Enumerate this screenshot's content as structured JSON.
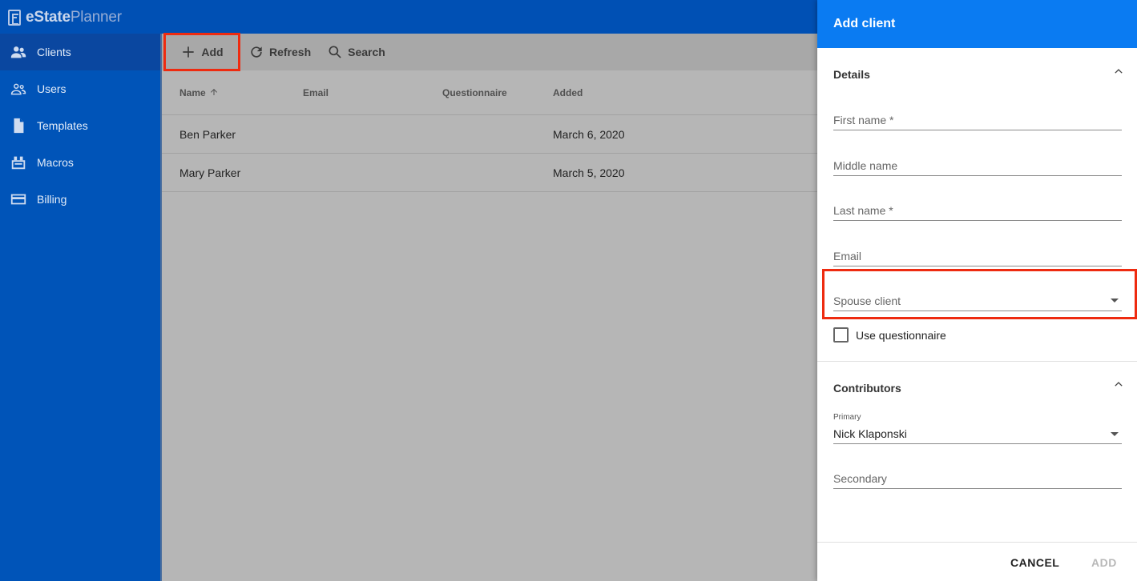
{
  "app": {
    "logo_bold": "eState",
    "logo_light": "Planner"
  },
  "sidebar": {
    "items": [
      {
        "label": "Clients",
        "icon": "people-icon",
        "active": true
      },
      {
        "label": "Users",
        "icon": "users-outline-icon"
      },
      {
        "label": "Templates",
        "icon": "document-icon"
      },
      {
        "label": "Macros",
        "icon": "macro-icon"
      },
      {
        "label": "Billing",
        "icon": "credit-card-icon"
      }
    ]
  },
  "toolbar": {
    "add_label": "Add",
    "refresh_label": "Refresh",
    "search_label": "Search"
  },
  "table": {
    "columns": [
      "Name",
      "Email",
      "Questionnaire",
      "Added"
    ],
    "rows": [
      {
        "name": "Ben Parker",
        "email": "",
        "questionnaire": "",
        "added": "March 6, 2020"
      },
      {
        "name": "Mary Parker",
        "email": "",
        "questionnaire": "",
        "added": "March 5, 2020"
      }
    ]
  },
  "panel": {
    "title": "Add client",
    "details": {
      "title": "Details",
      "first_name_label": "First name *",
      "middle_name_label": "Middle name",
      "last_name_label": "Last name *",
      "email_label": "Email",
      "spouse_label": "Spouse client",
      "use_questionnaire_label": "Use questionnaire"
    },
    "contributors": {
      "title": "Contributors",
      "primary_label": "Primary",
      "primary_value": "Nick Klaponski",
      "secondary_label": "Secondary"
    },
    "cancel_label": "CANCEL",
    "add_label": "ADD"
  },
  "colors": {
    "accent": "#0a7bf2",
    "sidebar": "#0054b8",
    "highlight": "#ee2b10"
  }
}
